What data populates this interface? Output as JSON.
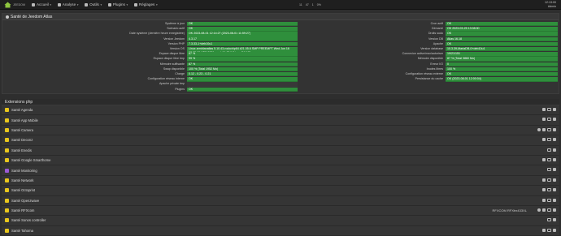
{
  "topbar": {
    "logo_text": "JEEDOM",
    "menu": [
      {
        "label": "Accueil",
        "icon": "home-icon"
      },
      {
        "label": "Analyse",
        "icon": "chart-icon"
      },
      {
        "label": "Outils",
        "icon": "wrench-icon"
      },
      {
        "label": "Plugins",
        "icon": "puzzle-icon"
      },
      {
        "label": "Réglages",
        "icon": "gear-icon"
      }
    ],
    "status_icons": [
      "11",
      "47",
      "1",
      "0%"
    ],
    "time": "12:13:00",
    "user": "Admin"
  },
  "health": {
    "title": "Santé de Jeedom Atlas",
    "left_rows": [
      {
        "label": "Système à jour",
        "value": "OK"
      },
      {
        "label": "Scénario actif",
        "value": "OK"
      },
      {
        "label": "Date système (dernière heure enregistrée)",
        "value": "OK 2023-08-01 12:14:27 (2023-08-01 11:59:27)"
      },
      {
        "label": "Version Jeedom",
        "value": "4.3.17"
      },
      {
        "label": "Version PHP",
        "value": "7.3.33-1+deb10u1"
      },
      {
        "label": "Version OS",
        "value": "Linux armbianatlas 5.10.43-rockchip64 #21.05.6 SMP PREEMPT Wed Jun 16 08:02:12 UTC 2021 aarch64 GNU/Linux [10.13]"
      },
      {
        "label": "Espace disque libre",
        "value": "87 %"
      },
      {
        "label": "Espace disque libre tmp",
        "value": "99 %"
      },
      {
        "label": "Mémoire suffisante",
        "value": "87 %"
      },
      {
        "label": "Swap disponible",
        "value": "100 % (Total 1952 Mo)"
      },
      {
        "label": "Charge",
        "value": "0.12 - 0.23 - 0.21"
      },
      {
        "label": "Configuration réseau interne",
        "value": "OK"
      },
      {
        "label": "Apache private tmp",
        "value": ""
      },
      {
        "label": "Plugins",
        "value": "OK"
      }
    ],
    "right_rows": [
      {
        "label": "Cron actif",
        "value": "OK"
      },
      {
        "label": "Démarré",
        "value": "OK 2023-03-25 13:08:00"
      },
      {
        "label": "Droits sudo",
        "value": "OK"
      },
      {
        "label": "Version DB",
        "value": "Atlas 16.18"
      },
      {
        "label": "Apache",
        "value": "OK"
      },
      {
        "label": "Version database",
        "value": "10.3.39-MariaDB-0+deb10u1"
      },
      {
        "label": "Connexion active/max/autoriser",
        "value": "19/21/151"
      },
      {
        "label": "Mémoire disponible",
        "value": "87 % (Total 3860 Mo)"
      },
      {
        "label": "Erreur I/O",
        "value": "0"
      },
      {
        "label": "Inodes libres",
        "value": "100 %"
      },
      {
        "label": "Configuration réseau externe",
        "value": "OK"
      },
      {
        "label": "Persistance du cache",
        "value": "OK (2023-08-01 12:00:04)"
      }
    ]
  },
  "extensions": {
    "title": "Extensions php",
    "plugins": [
      {
        "name": "Santé Agenda",
        "color": "#e9c71c",
        "actions": 3
      },
      {
        "name": "Santé App Mobile",
        "color": "#e9c71c",
        "actions": 3
      },
      {
        "name": "Santé Camera",
        "color": "#e9c71c",
        "actions": 4
      },
      {
        "name": "Santé Deconz",
        "color": "#e9c71c",
        "actions": 3
      },
      {
        "name": "Santé Enedis",
        "color": "#e9c71c",
        "actions": 2
      },
      {
        "name": "Santé Google Smarthome",
        "color": "#e9c71c",
        "actions": 3
      },
      {
        "name": "Santé Monitoring",
        "color": "#9b59d6",
        "actions": 2
      },
      {
        "name": "Santé Network",
        "color": "#e9c71c",
        "actions": 3
      },
      {
        "name": "Santé Octoprint",
        "color": "#e9c71c",
        "actions": 3
      },
      {
        "name": "Santé Openzwave",
        "color": "#e9c71c",
        "actions": 3
      },
      {
        "name": "Santé RFXcom",
        "color": "#e9c71c",
        "actions": 4,
        "extra": "RFXCOM RFXtrx433XL"
      },
      {
        "name": "Santé Sonos controller",
        "color": "#e9c71c",
        "actions": 2
      },
      {
        "name": "Santé Tahoma",
        "color": "#e9c71c",
        "actions": 3
      }
    ]
  }
}
